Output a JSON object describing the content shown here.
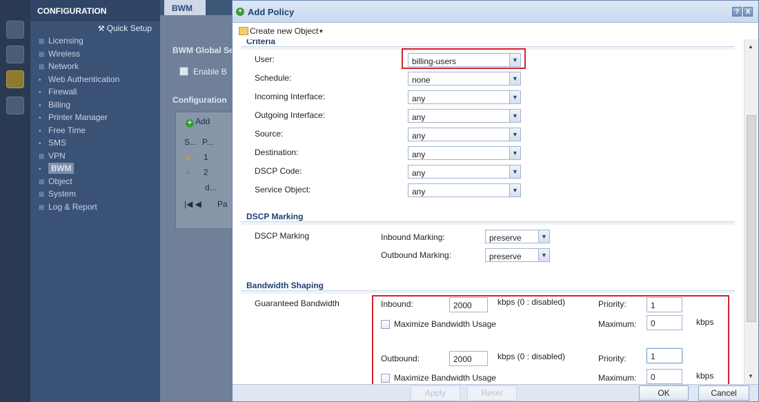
{
  "app": {
    "panel_title": "CONFIGURATION",
    "quick_setup": "Quick Setup",
    "nav": [
      {
        "mark": "⊞",
        "label": "Licensing"
      },
      {
        "mark": "⊞",
        "label": "Wireless"
      },
      {
        "mark": "⊞",
        "label": "Network"
      },
      {
        "mark": "•",
        "label": "Web Authentication"
      },
      {
        "mark": "•",
        "label": "Firewall"
      },
      {
        "mark": "•",
        "label": "Billing"
      },
      {
        "mark": "•",
        "label": "Printer Manager"
      },
      {
        "mark": "•",
        "label": "Free Time"
      },
      {
        "mark": "•",
        "label": "SMS"
      },
      {
        "mark": "⊞",
        "label": "VPN"
      },
      {
        "mark": "•",
        "label": "BWM"
      },
      {
        "mark": "⊞",
        "label": "Object"
      },
      {
        "mark": "⊞",
        "label": "System"
      },
      {
        "mark": "⊞",
        "label": "Log & Report"
      }
    ],
    "main_tab": "BWM",
    "bg": {
      "global_settings": "BWM Global Se",
      "enable": "Enable B",
      "configuration": "Configuration",
      "add": "Add",
      "col_s": "S...",
      "col_p": "P...",
      "row1": "1",
      "row2": "2",
      "row3": "d...",
      "pager": "Pa",
      "apply": "Apply",
      "reset": "Reset"
    }
  },
  "dialog": {
    "title": "Add Policy",
    "help_btn": "?",
    "close_btn": "X",
    "create_object": "Create new Object",
    "criteria_title": "Criteria",
    "criteria": [
      {
        "label": "User:",
        "value": "billing-users"
      },
      {
        "label": "Schedule:",
        "value": "none"
      },
      {
        "label": "Incoming Interface:",
        "value": "any"
      },
      {
        "label": "Outgoing Interface:",
        "value": "any"
      },
      {
        "label": "Source:",
        "value": "any"
      },
      {
        "label": "Destination:",
        "value": "any"
      },
      {
        "label": "DSCP Code:",
        "value": "any"
      },
      {
        "label": "Service Object:",
        "value": "any"
      }
    ],
    "dscp_section": "DSCP Marking",
    "dscp_label": "DSCP Marking",
    "inbound_marking_label": "Inbound Marking:",
    "inbound_marking_value": "preserve",
    "outbound_marking_label": "Outbound Marking:",
    "outbound_marking_value": "preserve",
    "bw_section": "Bandwidth Shaping",
    "guaranteed_label": "Guaranteed Bandwidth",
    "inbound_label": "Inbound:",
    "inbound_value": "2000",
    "inbound_unit": "kbps (0 : disabled)",
    "priority_label": "Priority:",
    "inbound_priority": "1",
    "max_usage_label": "Maximize Bandwidth Usage",
    "maximum_label": "Maximum:",
    "inbound_maximum": "0",
    "kbps": "kbps",
    "outbound_label": "Outbound:",
    "outbound_value": "2000",
    "outbound_unit": "kbps (0 : disabled)",
    "outbound_priority": "1",
    "outbound_maximum": "0",
    "ok": "OK",
    "cancel": "Cancel"
  }
}
